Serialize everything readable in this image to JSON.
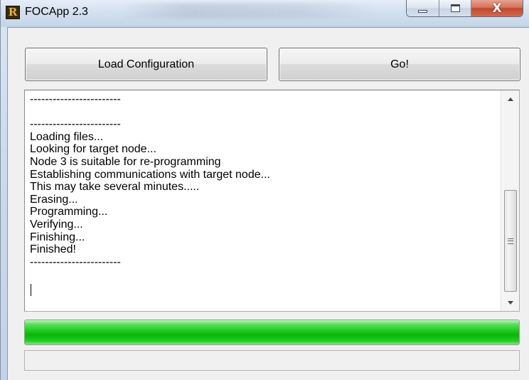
{
  "window": {
    "title": "FOCApp 2.3",
    "icon_letter": "R",
    "caption_buttons": {
      "minimize_icon": "minimize-icon",
      "maximize_icon": "maximize-icon",
      "close_glyph": "X"
    }
  },
  "toolbar": {
    "load_label": "Load Configuration",
    "go_label": "Go!"
  },
  "log": {
    "lines": [
      "------------------------",
      "",
      "------------------------",
      "Loading files...",
      "Looking for target node...",
      "Node 3 is suitable for re-programming",
      "Establishing communications with target node...",
      "This may take several minutes.....",
      "Erasing...",
      "Programming...",
      "Verifying...",
      "Finishing...",
      "Finished!",
      "------------------------",
      ""
    ]
  },
  "progress": {
    "percent": 100,
    "color": "#1ec81e"
  },
  "status": {
    "text": ""
  },
  "colors": {
    "accent_green": "#1ec81e",
    "close_red": "#c2482a"
  }
}
